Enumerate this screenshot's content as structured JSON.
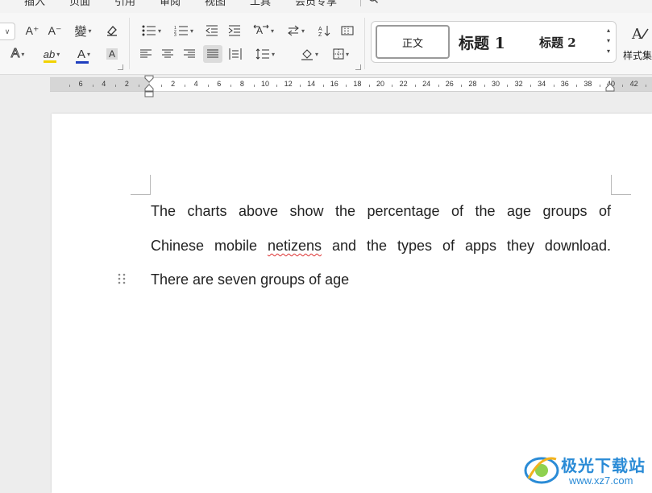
{
  "tabs": [
    "插入",
    "页面",
    "引用",
    "审阅",
    "视图",
    "工具",
    "会员专享"
  ],
  "ribbon": {
    "font_size_caret": "∨",
    "grow_font": "A⁺",
    "shrink_font": "A⁻",
    "phonetic": "變",
    "clear_format": "清除",
    "text_effect": "A",
    "highlight": "ab",
    "font_color": "A",
    "char_shading": "A",
    "accent_font_color": "#1f3fbf",
    "accent_highlight": "#f2d200"
  },
  "styles": {
    "normal": "正文",
    "heading1": "标题 1",
    "heading2": "标题 2",
    "style_set_label": "样式集"
  },
  "ruler": {
    "ticks": [
      "6",
      "4",
      "2",
      "2",
      "4",
      "6",
      "8",
      "10",
      "12",
      "14",
      "16",
      "18",
      "20",
      "22",
      "24",
      "26",
      "28",
      "30",
      "32",
      "34",
      "36",
      "38",
      "40",
      "42"
    ]
  },
  "document": {
    "line1": "The charts above show the percentage of the age groups of",
    "line2_before": "Chinese mobile ",
    "line2_flagged": "netizens",
    "line2_after": " and the types of apps they download.",
    "line3": "There are seven groups of age"
  },
  "watermark": {
    "text": "极光下载站",
    "url": "www.xz7.com"
  }
}
